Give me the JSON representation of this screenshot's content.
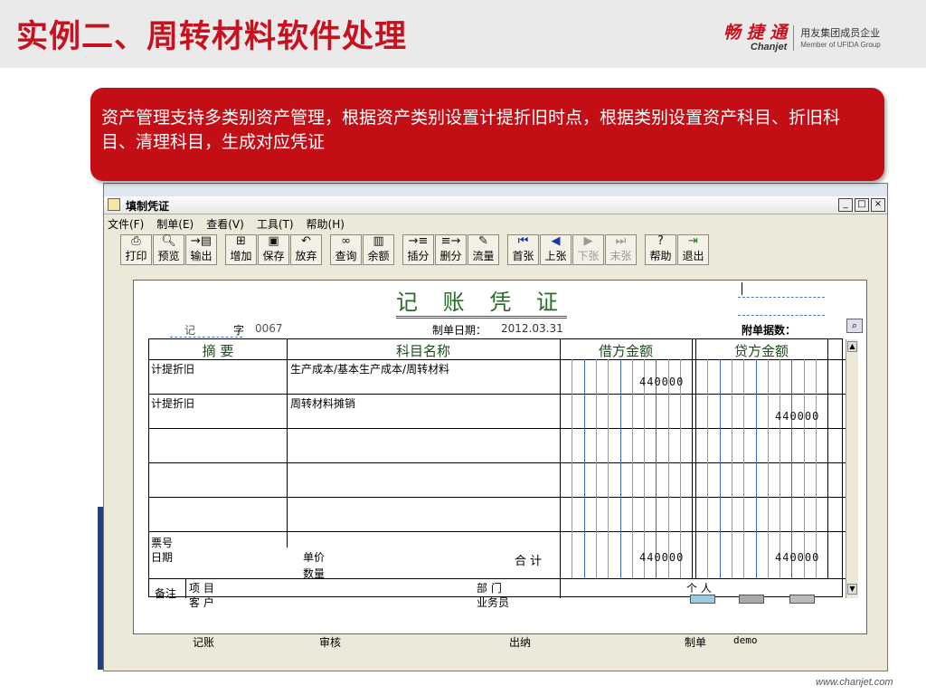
{
  "slide": {
    "title": "实例二、周转材料软件处理",
    "logo": {
      "cn": "畅 捷 通",
      "en": "Chanjet",
      "right_1": "用友集团成员企业",
      "right_2": "Member of UFIDA Group"
    },
    "callout": "资产管理支持多类别资产管理，根据资产类别设置计提折旧时点，根据类别设置资产科目、折旧科目、清理科目，生成对应凭证",
    "footer": "www.chanjet.com"
  },
  "window": {
    "title": "填制凭证",
    "menu": [
      "文件(F)",
      "制单(E)",
      "查看(V)",
      "工具(T)",
      "帮助(H)"
    ],
    "toolbar": [
      {
        "label": "打印",
        "icon": "printer-icon"
      },
      {
        "label": "预览",
        "icon": "preview-icon"
      },
      {
        "label": "输出",
        "icon": "export-icon"
      },
      {
        "label": "增加",
        "icon": "add-icon"
      },
      {
        "label": "保存",
        "icon": "save-icon"
      },
      {
        "label": "放弃",
        "icon": "undo-icon"
      },
      {
        "label": "查询",
        "icon": "binoculars-icon"
      },
      {
        "label": "余额",
        "icon": "bar-chart-icon"
      },
      {
        "label": "插分",
        "icon": "insert-row-icon"
      },
      {
        "label": "删分",
        "icon": "delete-row-icon"
      },
      {
        "label": "流量",
        "icon": "flow-icon"
      },
      {
        "label": "首张",
        "icon": "first-record-icon"
      },
      {
        "label": "上张",
        "icon": "prev-record-icon"
      },
      {
        "label": "下张",
        "icon": "next-record-icon",
        "disabled": true
      },
      {
        "label": "末张",
        "icon": "last-record-icon",
        "disabled": true
      },
      {
        "label": "帮助",
        "icon": "help-icon"
      },
      {
        "label": "退出",
        "icon": "exit-icon"
      }
    ]
  },
  "voucher": {
    "title": "记 账 凭 证",
    "type": "记",
    "zi": "字",
    "number": "0067",
    "date_label": "制单日期：",
    "date": "2012.03.31",
    "attach_label": "附单据数：",
    "columns": {
      "summary": "摘 要",
      "account": "科目名称",
      "debit": "借方金额",
      "credit": "贷方金额"
    },
    "rows": [
      {
        "summary": "计提折旧",
        "account": "生产成本/基本生产成本/周转材料",
        "debit": "440000",
        "credit": ""
      },
      {
        "summary": "计提折旧",
        "account": "周转材料摊销",
        "debit": "",
        "credit": "440000"
      },
      {
        "summary": "",
        "account": "",
        "debit": "",
        "credit": ""
      },
      {
        "summary": "",
        "account": "",
        "debit": "",
        "credit": ""
      },
      {
        "summary": "",
        "account": "",
        "debit": "",
        "credit": ""
      }
    ],
    "ticket_no_label": "票号",
    "date_row_label": "日期",
    "unit_price_label": "单价",
    "quantity_label": "数量",
    "total_label": "合 计",
    "total_debit": "440000",
    "total_credit": "440000",
    "remark_label": "备注",
    "project_label": "项  目",
    "customer_label": "客  户",
    "dept_label": "部  门",
    "salesman_label": "业务员",
    "person_label": "个  人",
    "sign": {
      "post": "记账",
      "audit": "审核",
      "cashier": "出纳",
      "maker": "制单",
      "maker_name": "demo"
    }
  },
  "colors": {
    "accent": "#c8101f",
    "callout": "#c40e16",
    "voucher_green": "#1a4e1a"
  }
}
